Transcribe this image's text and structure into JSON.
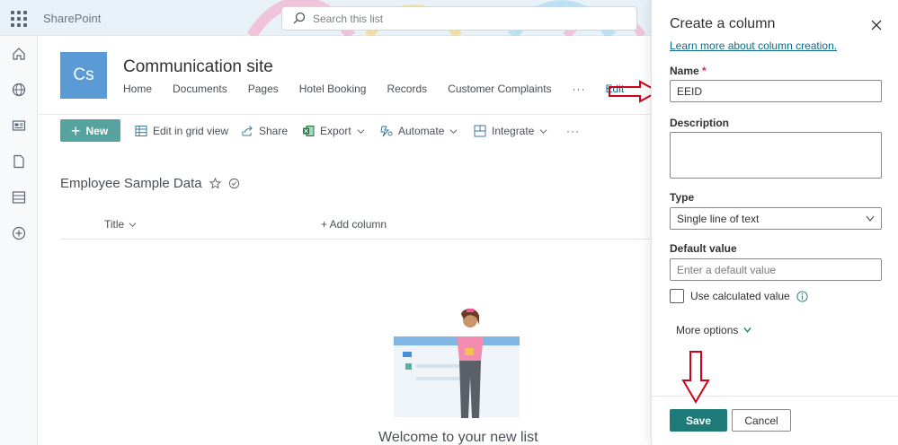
{
  "header": {
    "app_name": "SharePoint",
    "search_placeholder": "Search this list"
  },
  "site": {
    "logo_initials": "Cs",
    "title": "Communication site",
    "nav": [
      "Home",
      "Documents",
      "Pages",
      "Hotel Booking",
      "Records",
      "Customer Complaints"
    ],
    "nav_more": "···",
    "nav_edit": "Edit"
  },
  "commandbar": {
    "new_label": "New",
    "edit_grid": "Edit in grid view",
    "share": "Share",
    "export": "Export",
    "automate": "Automate",
    "integrate": "Integrate",
    "more": "···"
  },
  "list": {
    "title": "Employee Sample Data",
    "column_title": "Title",
    "add_column": "+ Add column",
    "welcome": "Welcome to your new list"
  },
  "panel": {
    "title": "Create a column",
    "learn_more": "Learn more about column creation.",
    "name_label": "Name",
    "required_mark": "*",
    "name_value": "EEID",
    "description_label": "Description",
    "type_label": "Type",
    "type_value": "Single line of text",
    "default_label": "Default value",
    "default_placeholder": "Enter a default value",
    "calculated_label": "Use calculated value",
    "more_options": "More options",
    "save_label": "Save",
    "cancel_label": "Cancel"
  },
  "colors": {
    "accent": "#1f7a7a",
    "new_button": "#55a29f",
    "site_logo": "#5a9bd5",
    "link": "#0b6a8c",
    "annotation_arrow": "#d0021b"
  }
}
